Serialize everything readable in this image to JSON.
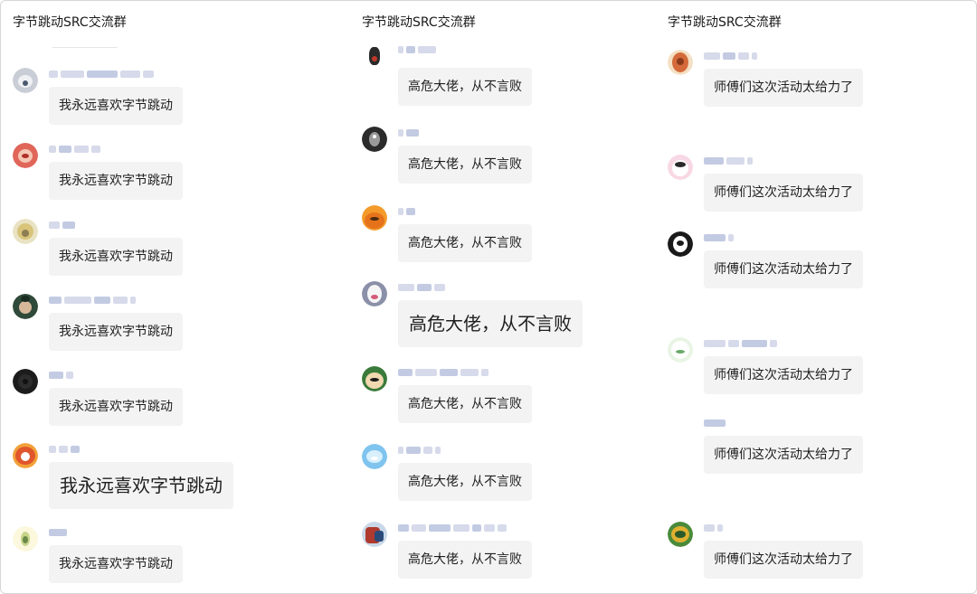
{
  "panels": [
    {
      "title": "字节跳动SRC交流群",
      "messages": [
        {
          "text": "我永远喜欢字节跳动",
          "avatar": [
            "#c9cdd6",
            "#eef0f3",
            "#4a5a70"
          ]
        },
        {
          "text": "我永远喜欢字节跳动",
          "avatar": [
            "#e0665a",
            "#f4c7b4",
            "#b0302a"
          ]
        },
        {
          "text": "我永远喜欢字节跳动",
          "avatar": [
            "#e9e3c4",
            "#d8c47a",
            "#8c7d52"
          ]
        },
        {
          "text": "我永远喜欢字节跳动",
          "avatar": [
            "#2f4a3a",
            "#d8b89a",
            "#1a2b20"
          ]
        },
        {
          "text": "我永远喜欢字节跳动",
          "avatar": [
            "#1c1c1c",
            "#2c2c2c",
            "#111111"
          ]
        },
        {
          "text": "我永远喜欢字节跳动",
          "avatar": [
            "#f2a13a",
            "#e0562c",
            "#ffffff"
          ]
        },
        {
          "text": "我永远喜欢字节跳动",
          "avatar": [
            "#fbf8de",
            "#c7d48a",
            "#6a8a4a"
          ]
        }
      ]
    },
    {
      "title": "字节跳动SRC交流群",
      "messages": [
        {
          "text": "高危大佬，从不言败",
          "avatar": [
            "#ffffff",
            "#2a2a2a",
            "#c0392b"
          ]
        },
        {
          "text": "高危大佬，从不言败",
          "avatar": [
            "#2b2b2b",
            "#9a9a9a",
            "#ffffff"
          ]
        },
        {
          "text": "高危大佬，从不言败",
          "avatar": [
            "#f39a2a",
            "#e6731b",
            "#4a2a10"
          ]
        },
        {
          "text": "高危大佬，从不言败",
          "avatar": [
            "#8a90a8",
            "#f5f5f5",
            "#d45a7a"
          ]
        },
        {
          "text": "高危大佬，从不言败",
          "avatar": [
            "#3a7a3a",
            "#f0d8b0",
            "#1a1a1a"
          ]
        },
        {
          "text": "高危大佬，从不言败",
          "avatar": [
            "#7fc4ee",
            "#d8f0fc",
            "#ffffff"
          ]
        },
        {
          "text": "高危大佬，从不言败",
          "avatar": [
            "#c9d8e8",
            "#b03a2e",
            "#2a4a7a"
          ]
        }
      ]
    },
    {
      "title": "字节跳动SRC交流群",
      "messages": [
        {
          "text": "师傅们这次活动太给力了",
          "avatar": [
            "#f4e0c4",
            "#d46a3a",
            "#8a3a1a"
          ]
        },
        {
          "text": "师傅们这次活动太给力了",
          "avatar": [
            "#f8d8e4",
            "#ffffff",
            "#2a2a2a"
          ]
        },
        {
          "text": "师傅们这次活动太给力了",
          "avatar": [
            "#1a1a1a",
            "#ffffff",
            "#1a1a1a"
          ]
        },
        {
          "text": "师傅们这次活动太给力了",
          "avatar": [
            "#e8f4e4",
            "#ffffff",
            "#6aa86a"
          ]
        },
        {
          "text": "师傅们这次活动太给力了",
          "avatar": [
            "#ffffff",
            "#ffffff",
            "#ffffff"
          ]
        },
        {
          "text": "师傅们这次活动太给力了",
          "avatar": [
            "#4a8a3a",
            "#e0b030",
            "#2a5a2a"
          ]
        }
      ]
    }
  ]
}
